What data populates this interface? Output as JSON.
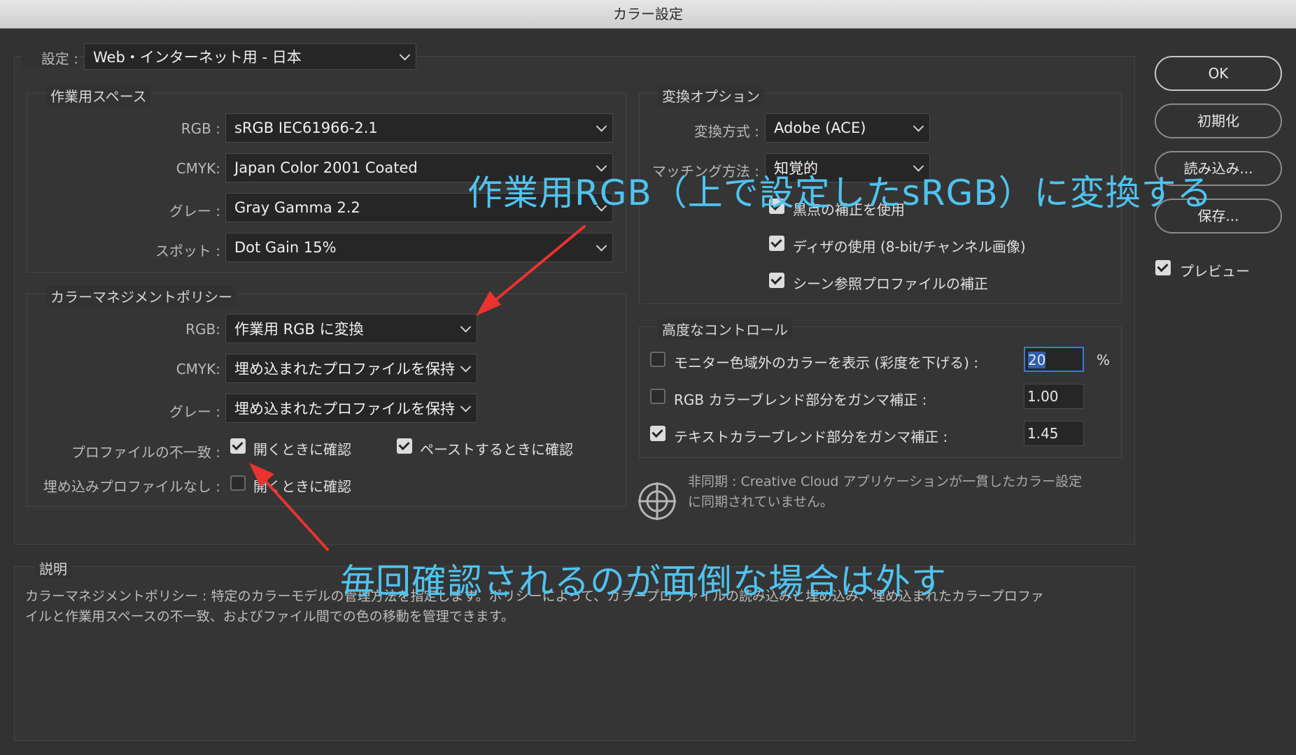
{
  "window": {
    "title": "カラー設定"
  },
  "settings": {
    "label": "設定 :",
    "value": "Web・インターネット用 - 日本"
  },
  "working_spaces": {
    "title": "作業用スペース",
    "rgb_label": "RGB :",
    "rgb_value": "sRGB IEC61966-2.1",
    "cmyk_label": "CMYK:",
    "cmyk_value": "Japan Color 2001 Coated",
    "gray_label": "グレー :",
    "gray_value": "Gray Gamma 2.2",
    "spot_label": "スポット :",
    "spot_value": "Dot Gain 15%"
  },
  "policies": {
    "title": "カラーマネジメントポリシー",
    "rgb_label": "RGB:",
    "rgb_value": "作業用 RGB に変換",
    "cmyk_label": "CMYK:",
    "cmyk_value": "埋め込まれたプロファイルを保持",
    "gray_label": "グレー :",
    "gray_value": "埋め込まれたプロファイルを保持",
    "mismatch_label": "プロファイルの不一致 :",
    "mismatch_open": "開くときに確認",
    "mismatch_paste": "ペーストするときに確認",
    "missing_label": "埋め込みプロファイルなし :",
    "missing_open": "開くときに確認"
  },
  "conversion": {
    "title": "変換オプション",
    "engine_label": "変換方式 :",
    "engine_value": "Adobe (ACE)",
    "intent_label": "マッチング方法 :",
    "intent_value": "知覚的",
    "bpc": "黒点の補正を使用",
    "dither": "ディザの使用 (8-bit/チャンネル画像)",
    "scene": "シーン参照プロファイルの補正"
  },
  "advanced": {
    "title": "高度なコントロール",
    "desaturate_label": "モニター色域外のカラーを表示 (彩度を下げる) :",
    "desaturate_value": "20",
    "percent": "%",
    "rgb_blend_label": "RGB カラーブレンド部分をガンマ補正 :",
    "rgb_blend_value": "1.00",
    "text_blend_label": "テキストカラーブレンド部分をガンマ補正 :",
    "text_blend_value": "1.45"
  },
  "sync": {
    "line1": "非同期 : Creative Cloud アプリケーションが一貫したカラー設定",
    "line2": "に同期されていません。"
  },
  "description": {
    "title": "説明",
    "line1": "カラーマネジメントポリシー : 特定のカラーモデルの管理方法を指定します。ポリシーによって、カラープロファイルの読み込みと埋め込み、埋め込まれたカラープロファ",
    "line2": "イルと作業用スペースの不一致、およびファイル間での色の移動を管理できます。"
  },
  "buttons": {
    "ok": "OK",
    "reset": "初期化",
    "load": "読み込み...",
    "save": "保存...",
    "preview": "プレビュー"
  },
  "annotations": {
    "top": "作業用RGB（上で設定したsRGB）に変換する",
    "bottom": "毎回確認されるのが面倒な場合は外す",
    "color": "#4fc3ef",
    "arrow_color": "#e8332e"
  }
}
